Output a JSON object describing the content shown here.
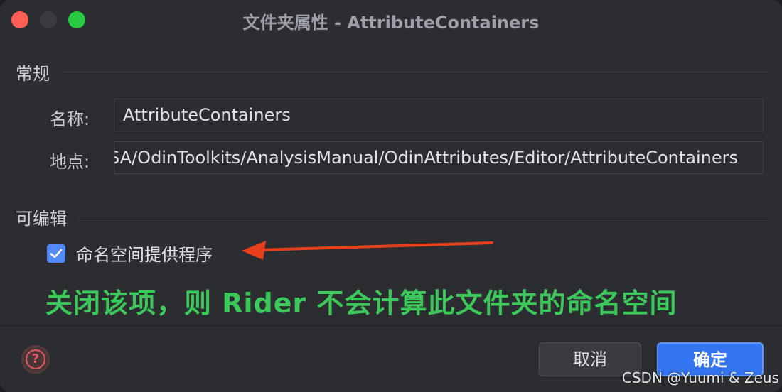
{
  "window": {
    "title": "文件夹属性 - AttributeContainers"
  },
  "general": {
    "header": "常规",
    "name_label": "名称:",
    "name_value": "AttributeContainers",
    "location_label": "地点:",
    "location_value": "SA/OdinToolkits/AnalysisManual/OdinAttributes/Editor/AttributeContainers"
  },
  "editable": {
    "header": "可编辑",
    "namespace_provider_label": "命名空间提供程序",
    "namespace_provider_checked": true
  },
  "annotation": {
    "text": "关闭该项，则 Rider 不会计算此文件夹的命名空间",
    "color": "#3cc85a",
    "arrow_color": "#e8401c"
  },
  "footer": {
    "help_icon": "question-circle-icon",
    "cancel_label": "取消",
    "ok_label": "确定"
  },
  "watermark": "CSDN @Yuumi & Zeus",
  "colors": {
    "accent": "#3574f0",
    "checkbox": "#548af7",
    "close": "#ff5f57",
    "maximize": "#28c840"
  }
}
